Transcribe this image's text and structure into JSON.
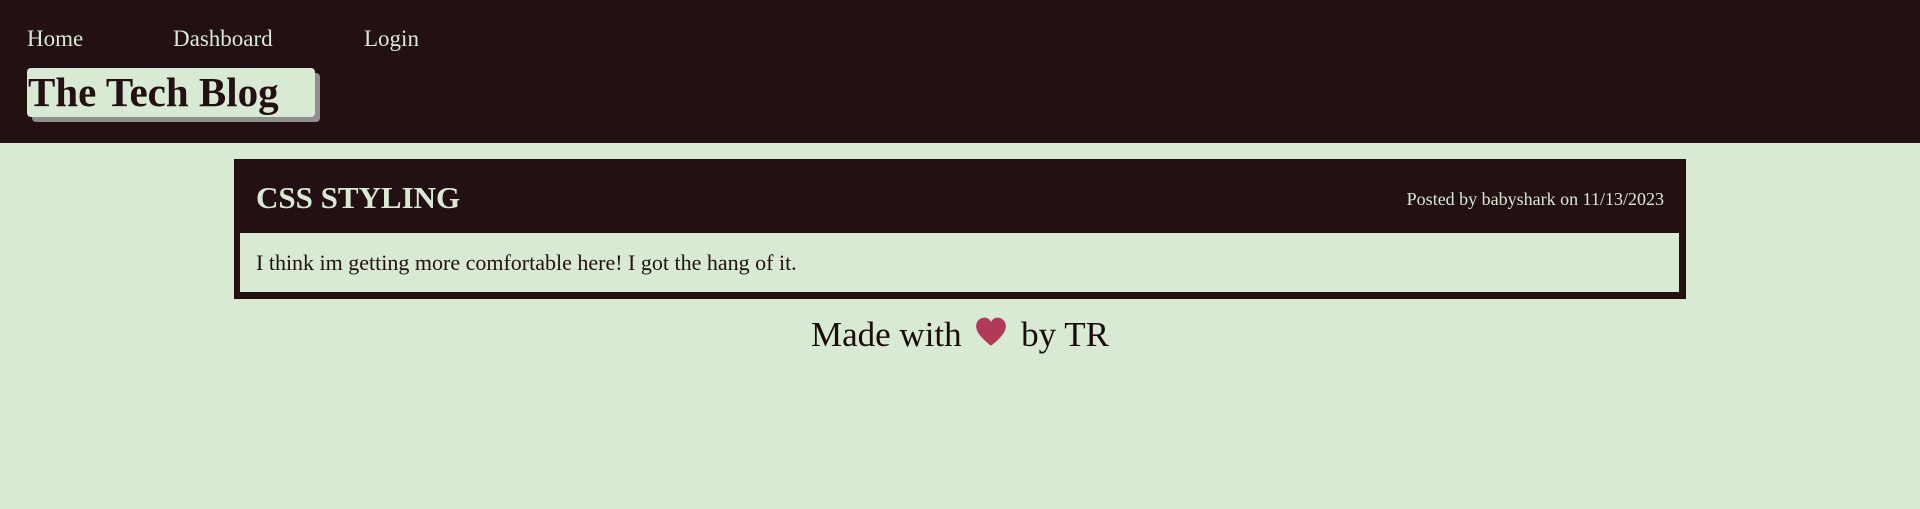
{
  "colors": {
    "dark": "#231012",
    "light": "#d8ead3",
    "heart": "#b03a58"
  },
  "nav": {
    "home": "Home",
    "dashboard": "Dashboard",
    "login": "Login"
  },
  "brand": {
    "title": "The Tech Blog"
  },
  "post": {
    "title": "CSS STYLING",
    "meta": "Posted by babyshark on 11/13/2023",
    "body": "I think im getting more comfortable here! I got the hang of it."
  },
  "footer": {
    "prefix": "Made with",
    "icon": "heart-icon",
    "suffix": "by TR"
  }
}
